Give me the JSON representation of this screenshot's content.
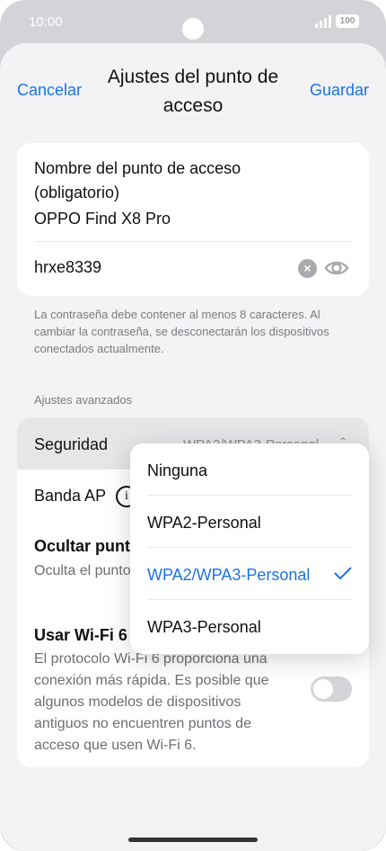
{
  "status": {
    "time": "10:00",
    "battery": "100"
  },
  "header": {
    "cancel": "Cancelar",
    "title": "Ajustes del punto de acceso",
    "save": "Guardar"
  },
  "hotspot": {
    "name_label": "Nombre del punto de acceso (obligatorio)",
    "name_value": "OPPO Find X8 Pro",
    "password_value": "hrxe8339"
  },
  "hint": "La contraseña debe contener al menos 8 caracteres. Al cambiar la contraseña, se desconectarán los dispositivos conectados actualmente.",
  "advanced": {
    "section_title": "Ajustes avanzados",
    "security_label": "Seguridad",
    "security_value": "WPA2/WPA3-Personal",
    "band_label": "Banda AP",
    "hide_title": "Ocultar punto",
    "hide_desc": "Oculta el punto solo sea posib",
    "wifi6_title": "Usar Wi-Fi 6",
    "wifi6_desc": "El protocolo Wi-Fi 6 proporciona una conexión más rápida. Es posible que algunos modelos de dispositivos antiguos no encuentren puntos de acceso que usen Wi-Fi 6.",
    "wifi6_enabled": false
  },
  "dropdown": {
    "options": [
      "Ninguna",
      "WPA2-Personal",
      "WPA2/WPA3-Personal",
      "WPA3-Personal"
    ],
    "selected_index": 2
  },
  "colors": {
    "accent": "#1a73e8"
  },
  "icons": [
    "clear-icon",
    "eye-icon",
    "info-icon",
    "check-icon",
    "chevron-icon"
  ]
}
